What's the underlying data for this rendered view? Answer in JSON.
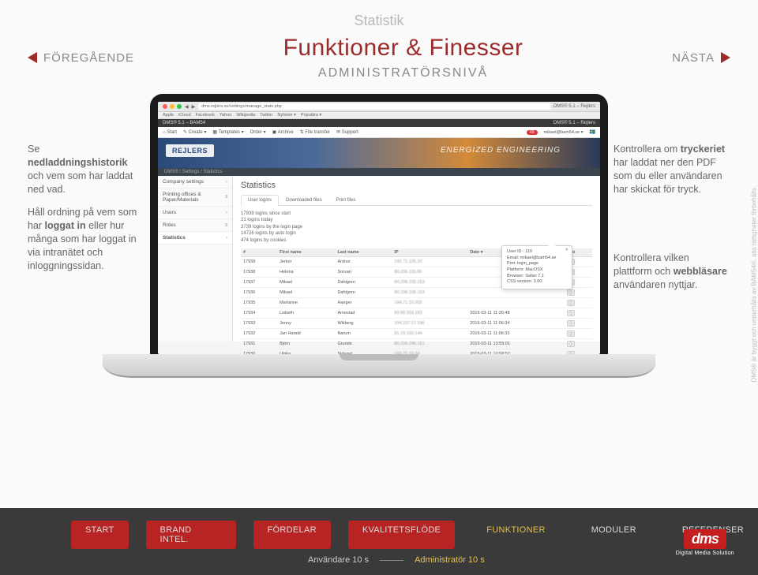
{
  "nav": {
    "prev": "FÖREGÅENDE",
    "next": "NÄSTA"
  },
  "header": {
    "title": "Funktioner & Finesser",
    "subtitle": "ADMINISTRATÖRSNIVÅ",
    "section": "Statistik"
  },
  "callouts": {
    "c1_a": "Se ",
    "c1_b": "nedladdningshistorik",
    "c1_c": " och vem som har laddat ned vad.",
    "c2_a": "Håll ordning på vem som har ",
    "c2_b": "loggat in",
    "c2_c": " eller hur många som har loggat in via intranätet och inloggningssidan.",
    "c3_a": "Kontrollera om ",
    "c3_b": "tryckeriet",
    "c3_c": " har laddat ner den PDF som du eller användaren har skickat för tryck.",
    "c4_a": "Kontrollera vilken plattform och ",
    "c4_b": "webbläsare",
    "c4_c": " användaren nyttjar."
  },
  "browser": {
    "page_title": "DMS® 5.1 – Rejlers",
    "url": "dms.rejlers.se/settings/manage_stats.php",
    "bookmarks": [
      "Apple",
      "iCloud",
      "Facebook",
      "Yahoo",
      "Wikipedia",
      "Twitter",
      "Nyheter ▾",
      "Populära ▾"
    ]
  },
  "appbar": {
    "left": "DMS® 5.1 – BAM54",
    "right": "DMS® 5.1 – Rejlers"
  },
  "appnav": {
    "items": [
      "⌂ Start",
      "✎ Create ▾",
      "▦ Templates ▾",
      "Order ▾",
      "▣ Archive",
      "⇅ File transfer",
      "✉ Support"
    ],
    "badge": "69",
    "user": "mikael@bam54.se ▾",
    "flag": "🇸🇪"
  },
  "hero": {
    "logo": "REJLERS",
    "tagline": "ENERGIZED ENGINEERING"
  },
  "breadcrumb": "DMS® / Settings / Statistics",
  "sidebar": {
    "items": [
      {
        "label": "Company settings",
        "count": ""
      },
      {
        "label": "Printing offices & Paper/Materials",
        "count": "3"
      },
      {
        "label": "Users",
        "count": "3"
      },
      {
        "label": "Roles",
        "count": "3"
      },
      {
        "label": "Statistics",
        "count": ""
      }
    ]
  },
  "panel": {
    "title": "Statistics",
    "tabs": [
      "User logins",
      "Downloaded files",
      "Print files"
    ],
    "stats": [
      "17939 logins since start",
      "21 logins today",
      "3739 logins by the login page",
      "14726 logins by auto login",
      "474 logins by cookies"
    ],
    "columns": [
      "#",
      "First name",
      "Last name",
      "IP",
      "Date ▾",
      "Info"
    ],
    "rows": [
      {
        "n": "17939",
        "first": "Jerker",
        "last": "Ardnor",
        "ip": "192.71.105.20",
        "date": "",
        "info": "ⓘ"
      },
      {
        "n": "17938",
        "first": "Helena",
        "last": "Sorvari",
        "ip": "80.206.115.99",
        "date": "",
        "info": "ⓘ"
      },
      {
        "n": "17937",
        "first": "Mikael",
        "last": "Dahlgren",
        "ip": "80.208.226.153",
        "date": "",
        "info": "ⓘ"
      },
      {
        "n": "17936",
        "first": "Mikael",
        "last": "Dahlgren",
        "ip": "80.208.226.153",
        "date": "",
        "info": "ⓘ"
      },
      {
        "n": "17935",
        "first": "Marianne",
        "last": "Haeger",
        "ip": "194.71.10.203",
        "date": "",
        "info": "ⓘ"
      },
      {
        "n": "17934",
        "first": "Lisbeth",
        "last": "Arnestad",
        "ip": "83.68.203.183",
        "date": "2015-03-11 11:26:48",
        "info": "ⓘ"
      },
      {
        "n": "17933",
        "first": "Jenny",
        "last": "Wikberg",
        "ip": "194.237.17.196",
        "date": "2015-03-11 11:06:34",
        "info": "ⓘ"
      },
      {
        "n": "17932",
        "first": "Jan Harald",
        "last": "Narum",
        "ip": "81.19.192.144",
        "date": "2015-03-11 11:06:33",
        "info": "ⓘ"
      },
      {
        "n": "17931",
        "first": "Björn",
        "last": "Grunde",
        "ip": "80.206.246.151",
        "date": "2015-03-11 10:59:01",
        "info": "ⓘ"
      },
      {
        "n": "17930",
        "first": "Ulrika",
        "last": "Sjölund",
        "ip": "192.71.10.24",
        "date": "2015-03-11 10:58:57",
        "info": "ⓘ"
      }
    ]
  },
  "tooltip": {
    "lines": [
      "User ID : 119",
      "Email: mikael@bam54.se",
      "Port: login_page",
      "Platform: MacOSX",
      "Browser: Safari 7.1",
      "CSS version: 3.00"
    ]
  },
  "footer": {
    "tabs": [
      "START",
      "BRAND INTEL.",
      "FÖRDELAR",
      "KVALITETSFLÖDE",
      "FUNKTIONER",
      "MODULER",
      "REFERENSER"
    ],
    "sub_a": "Användare 10 s",
    "sub_b": "Administratör 10 s"
  },
  "logo": {
    "mark": "dms",
    "tag": "Digital Media Solution"
  },
  "copyright": "DMS® är byggt och underhålls av BAM54®, alla rättigheter förbehålls."
}
